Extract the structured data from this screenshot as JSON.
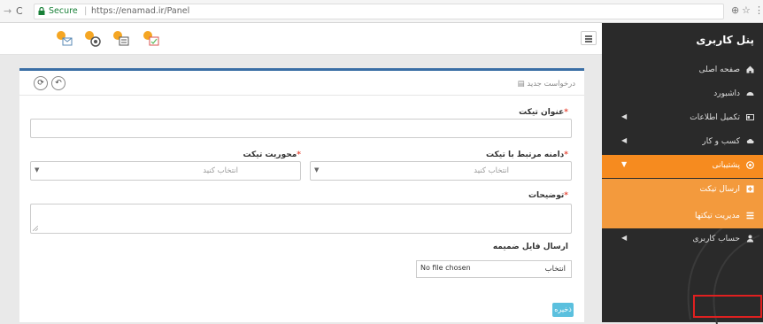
{
  "browser": {
    "secure_label": "Secure",
    "separator": "|",
    "url": "https://enamad.ir/Panel",
    "back_icon": "back-arrow-icon",
    "reload_icon": "reload-icon"
  },
  "sidebar": {
    "title": "پنل کاربری",
    "items": [
      {
        "label": "صفحه اصلی",
        "icon": "home-icon"
      },
      {
        "label": "داشبورد",
        "icon": "dashboard-icon"
      },
      {
        "label": "تکمیل اطلاعات",
        "icon": "id-card-icon"
      },
      {
        "label": "کسب و کار",
        "icon": "cloud-icon"
      },
      {
        "label": "پشتیبانی",
        "icon": "support-icon"
      },
      {
        "label": "ارسال تیکت",
        "icon": "plus-square-icon"
      },
      {
        "label": "مدیریت تیکتها",
        "icon": "list-icon"
      },
      {
        "label": "حساب کاربری",
        "icon": "user-icon"
      }
    ]
  },
  "panel": {
    "breadcrumb": "درخواست جدید",
    "subject_label": "عنوان تیکت",
    "domain_label": "دامنه مرتبط با تیکت",
    "topic_label": "محوریت تیکت",
    "select_placeholder": "انتخاب کنید",
    "description_label": "توضیحات",
    "attachment_label": "ارسال فایل ضمیمه",
    "choose_label": "انتخاب",
    "no_file": "No file chosen",
    "save_label": "ذخیره",
    "required_mark": "*"
  },
  "colors": {
    "accent": "#f68b1f",
    "sidebar_bg": "#2a2a2a",
    "panel_top": "#3a6ea5",
    "save_button": "#5bc0de",
    "highlight": "#e02020"
  }
}
